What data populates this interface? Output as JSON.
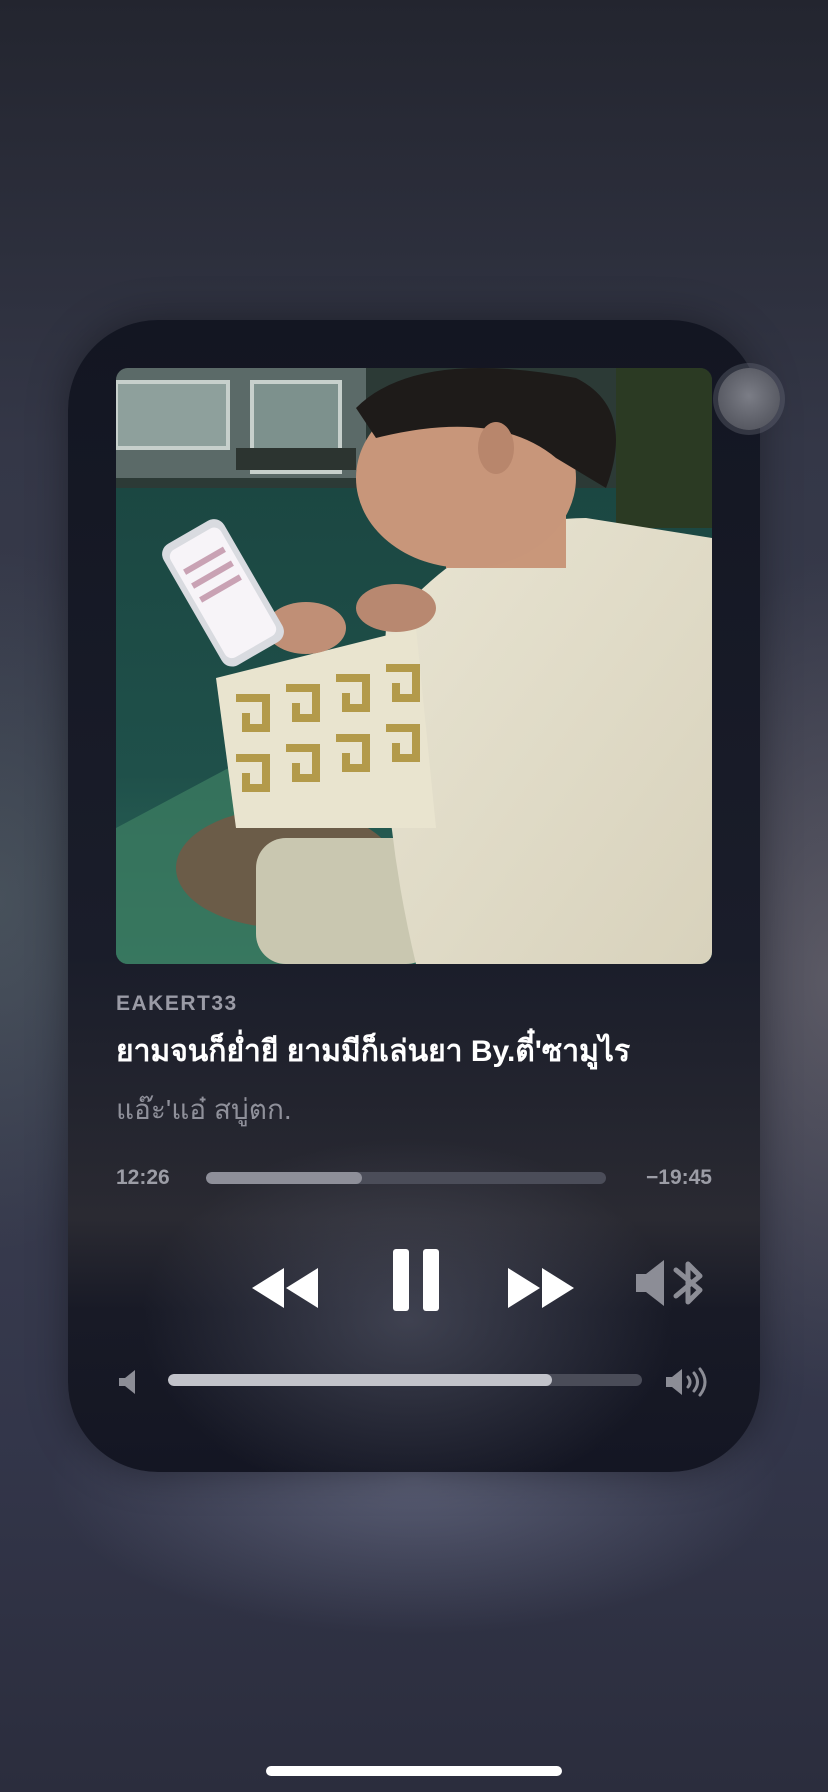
{
  "now_playing": {
    "artist": "EAKERT33",
    "title": "ยามจนก็ย่ำยี ยามมีก็เล่นยา By.ตี๋'ซามูไร",
    "subtitle": "แอ๊ะ'แอ๋ สบู่ตก.",
    "artwork_icon": "album-artwork"
  },
  "playback": {
    "elapsed": "12:26",
    "remaining": "−19:45",
    "progress_fraction": 0.39
  },
  "controls": {
    "rewind_icon": "rewind-icon",
    "pause_icon": "pause-icon",
    "forward_icon": "fast-forward-icon",
    "route_icon": "bluetooth-speaker-icon"
  },
  "volume": {
    "level_fraction": 0.81,
    "low_icon": "volume-low-icon",
    "high_icon": "volume-high-icon"
  },
  "colors": {
    "accent_white": "#ffffff",
    "secondary_text": "#9a9ba6",
    "track": "#4b4d59"
  }
}
